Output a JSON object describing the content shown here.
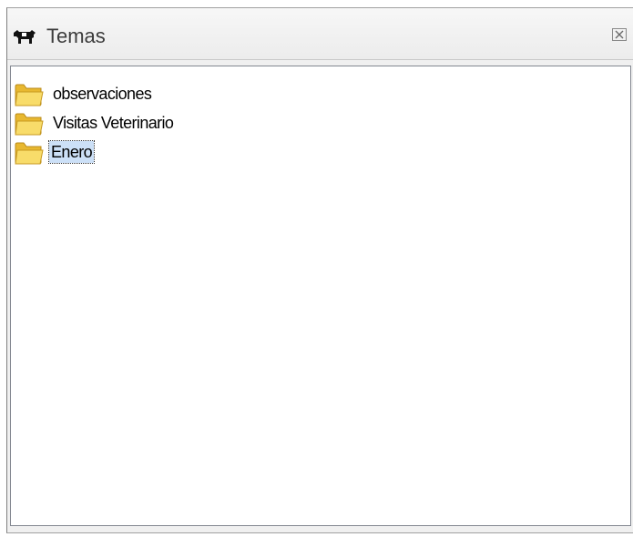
{
  "window": {
    "title": "Temas",
    "title_icon": "cow-icon",
    "close_icon": "close-icon"
  },
  "tree": {
    "items": [
      {
        "label": "observaciones",
        "icon": "folder-icon",
        "selected": false
      },
      {
        "label": "Visitas Veterinario",
        "icon": "folder-icon",
        "selected": false
      },
      {
        "label": "Enero",
        "icon": "folder-icon",
        "selected": true
      }
    ]
  },
  "colors": {
    "selection": "#cce0f7",
    "folder": "#f6d24f",
    "border": "#828790"
  }
}
